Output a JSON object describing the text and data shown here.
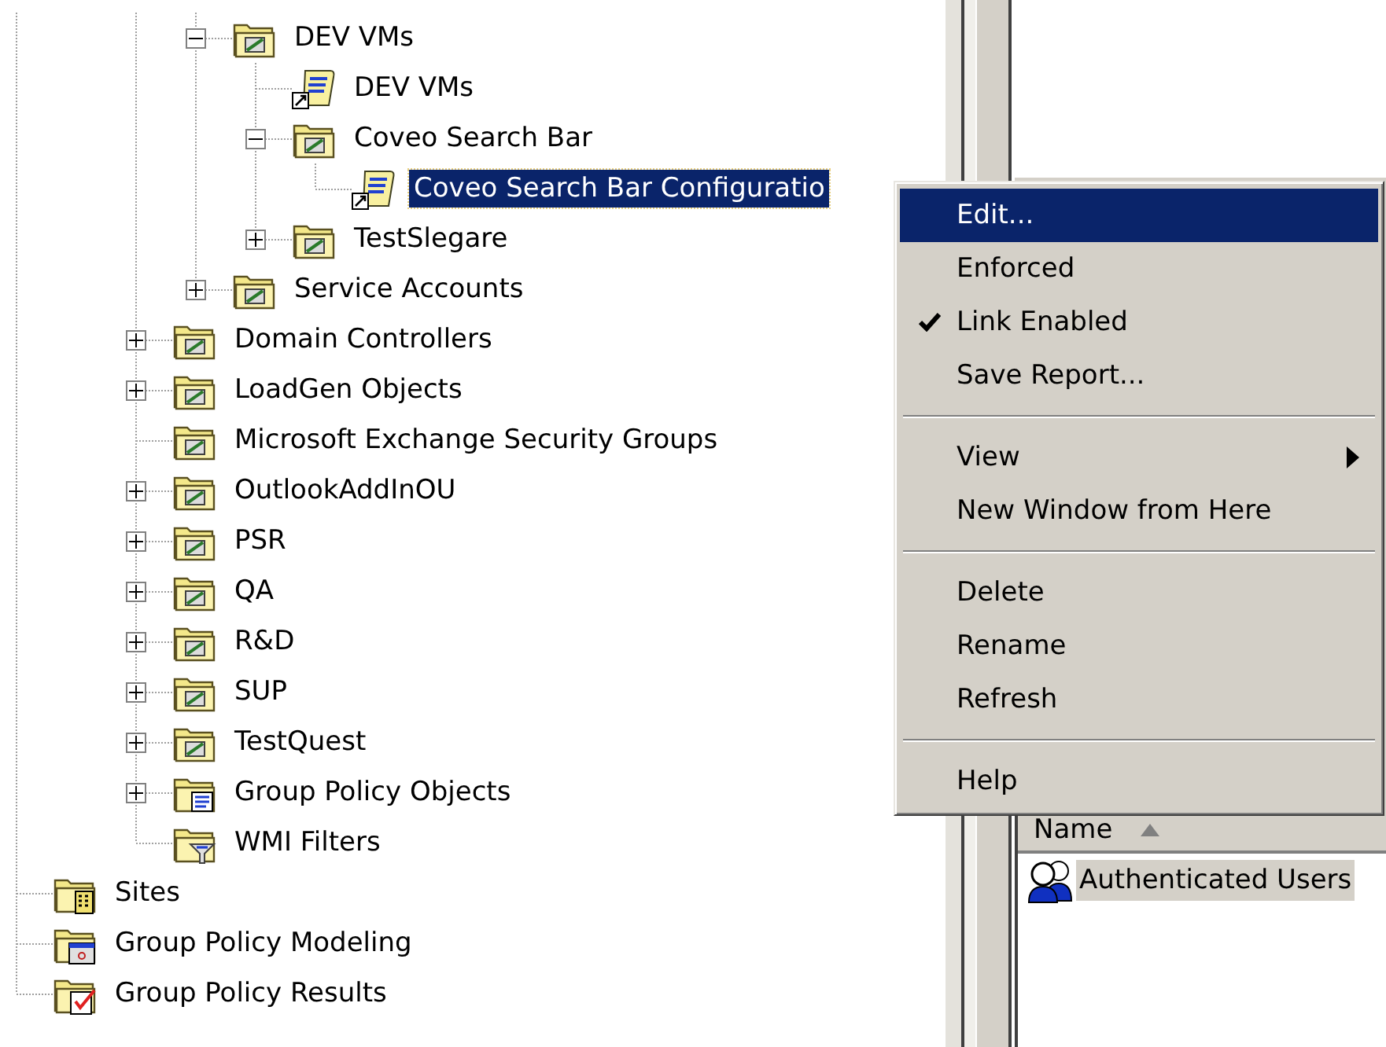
{
  "tree": [
    {
      "children": [
        {
          "children": [
            {
              "children": [
                {
                  "label": "DEV VMs",
                  "kind": "ou",
                  "expander": true,
                  "expanded": true,
                  "selected": false,
                  "children": [
                    {
                      "label": "DEV VMs",
                      "kind": "link",
                      "expander": false,
                      "selected": false
                    },
                    {
                      "label": "Coveo Search Bar",
                      "kind": "ou",
                      "expander": true,
                      "expanded": true,
                      "selected": false,
                      "children": [
                        {
                          "label": "Coveo Search Bar Configuratio",
                          "kind": "link",
                          "expander": false,
                          "selected": true
                        }
                      ]
                    },
                    {
                      "label": "TestSlegare",
                      "kind": "ou",
                      "expander": true,
                      "expanded": false,
                      "selected": false
                    }
                  ]
                },
                {
                  "label": "Service Accounts",
                  "kind": "ou",
                  "expander": true,
                  "expanded": false,
                  "selected": false
                }
              ]
            },
            {
              "label": "Domain Controllers",
              "kind": "ou",
              "expander": true,
              "expanded": false,
              "selected": false
            },
            {
              "label": "LoadGen Objects",
              "kind": "ou",
              "expander": true,
              "expanded": false,
              "selected": false
            },
            {
              "label": "Microsoft Exchange Security Groups",
              "kind": "ou",
              "expander": false,
              "selected": false
            },
            {
              "label": "OutlookAddInOU",
              "kind": "ou",
              "expander": true,
              "expanded": false,
              "selected": false
            },
            {
              "label": "PSR",
              "kind": "ou",
              "expander": true,
              "expanded": false,
              "selected": false
            },
            {
              "label": "QA",
              "kind": "ou",
              "expander": true,
              "expanded": false,
              "selected": false
            },
            {
              "label": "R&D",
              "kind": "ou",
              "expander": true,
              "expanded": false,
              "selected": false
            },
            {
              "label": "SUP",
              "kind": "ou",
              "expander": true,
              "expanded": false,
              "selected": false
            },
            {
              "label": "TestQuest",
              "kind": "ou",
              "expander": true,
              "expanded": false,
              "selected": false
            },
            {
              "label": "Group Policy Objects",
              "kind": "policies",
              "expander": true,
              "expanded": false,
              "selected": false
            },
            {
              "label": "WMI Filters",
              "kind": "filters",
              "expander": false,
              "selected": false
            }
          ]
        }
      ]
    },
    {
      "label": "Sites",
      "kind": "sites",
      "expander": false,
      "selected": false
    },
    {
      "label": "Group Policy Modeling",
      "kind": "modeling",
      "expander": false,
      "selected": false
    },
    {
      "label": "Group Policy Results",
      "kind": "results",
      "expander": false,
      "selected": false
    }
  ],
  "security_list": {
    "columns": [
      {
        "label": "Name",
        "sorted": true
      }
    ],
    "rows": [
      {
        "name": "Authenticated Users",
        "selected": true
      }
    ]
  },
  "context_menu": [
    {
      "kind": "item",
      "label": "Edit...",
      "selected": true,
      "checked": false,
      "submenu": false
    },
    {
      "kind": "item",
      "label": "Enforced",
      "selected": false,
      "checked": false,
      "submenu": false
    },
    {
      "kind": "item",
      "label": "Link Enabled",
      "selected": false,
      "checked": true,
      "submenu": false
    },
    {
      "kind": "item",
      "label": "Save Report...",
      "selected": false,
      "checked": false,
      "submenu": false
    },
    {
      "kind": "separator"
    },
    {
      "kind": "item",
      "label": "View",
      "selected": false,
      "checked": false,
      "submenu": true
    },
    {
      "kind": "item",
      "label": "New Window from Here",
      "selected": false,
      "checked": false,
      "submenu": false
    },
    {
      "kind": "separator"
    },
    {
      "kind": "item",
      "label": "Delete",
      "selected": false,
      "checked": false,
      "submenu": false
    },
    {
      "kind": "item",
      "label": "Rename",
      "selected": false,
      "checked": false,
      "submenu": false
    },
    {
      "kind": "item",
      "label": "Refresh",
      "selected": false,
      "checked": false,
      "submenu": false
    },
    {
      "kind": "separator"
    },
    {
      "kind": "item",
      "label": "Help",
      "selected": false,
      "checked": false,
      "submenu": false
    }
  ]
}
